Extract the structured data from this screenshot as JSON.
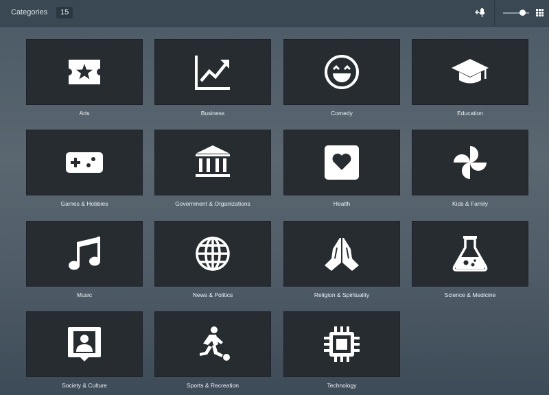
{
  "header": {
    "title": "Categories",
    "count": "15"
  },
  "tiles": [
    {
      "label": "Arts",
      "icon": "ticket-star-icon"
    },
    {
      "label": "Business",
      "icon": "trending-chart-icon"
    },
    {
      "label": "Comedy",
      "icon": "laughing-face-icon"
    },
    {
      "label": "Education",
      "icon": "graduation-cap-icon"
    },
    {
      "label": "Games & Hobbies",
      "icon": "gamepad-icon"
    },
    {
      "label": "Government & Organizations",
      "icon": "government-building-icon"
    },
    {
      "label": "Health",
      "icon": "heart-icon"
    },
    {
      "label": "Kids & Family",
      "icon": "pinwheel-icon"
    },
    {
      "label": "Music",
      "icon": "music-note-icon"
    },
    {
      "label": "News & Politics",
      "icon": "globe-icon"
    },
    {
      "label": "Religion & Spirituality",
      "icon": "praying-hands-icon"
    },
    {
      "label": "Science & Medicine",
      "icon": "flask-icon"
    },
    {
      "label": "Society & Culture",
      "icon": "person-badge-icon"
    },
    {
      "label": "Sports & Recreation",
      "icon": "soccer-player-icon"
    },
    {
      "label": "Technology",
      "icon": "chip-icon"
    }
  ],
  "colors": {
    "tile_background": "#262c30",
    "topbar_background": "#394852",
    "icon_color": "#ffffff"
  }
}
